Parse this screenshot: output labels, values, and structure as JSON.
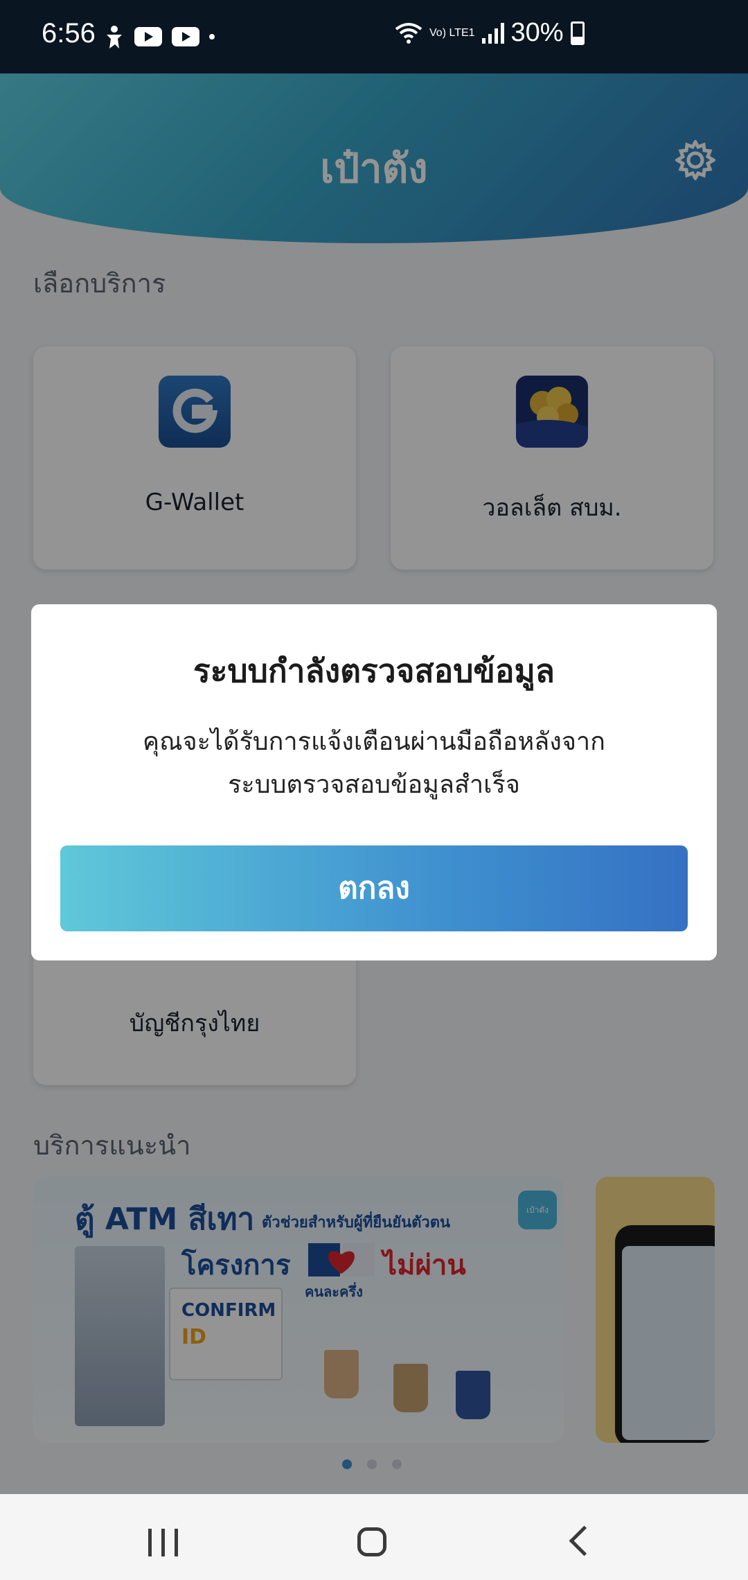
{
  "status_bar": {
    "time": "6:56",
    "network_label": "Vo) LTE1",
    "battery": "30%"
  },
  "header": {
    "title": "เป๋าตัง"
  },
  "services": {
    "section_title": "เลือกบริการ",
    "items": [
      {
        "label": "G-Wallet",
        "icon": "g-wallet-icon"
      },
      {
        "label": "วอลเล็ต สบม.",
        "icon": "coins-wallet-icon"
      },
      {
        "label": "บัญชีกรุงไทย",
        "icon": "ktb-account-icon"
      }
    ]
  },
  "recommended": {
    "section_title": "บริการแนะนำ",
    "banner1": {
      "title": "ตู้ ATM สีเทา",
      "subtitle": "ตัวช่วยสำหรับผู้ที่ยืนยันตัวตน",
      "project": "โครงการ",
      "not_pass": "ไม่ผ่าน",
      "half_half": "คนละครึ่ง",
      "confirm": "CONFIRM",
      "confirm_id": "ID",
      "badge": "เป๋าตัง"
    },
    "pager": {
      "count": 3,
      "active": 1
    }
  },
  "dialog": {
    "title": "ระบบกำลังตรวจสอบข้อมูล",
    "message_line1": "คุณจะได้รับการแจ้งเตือนผ่านมือถือหลังจาก",
    "message_line2": "ระบบตรวจสอบข้อมูลสำเร็จ",
    "ok_button": "ตกลง"
  },
  "colors": {
    "header_gradient": [
      "#5ed1e3",
      "#2f74b5"
    ],
    "button_gradient": [
      "#5fc8d9",
      "#3571c3"
    ],
    "brand_blue": "#1d4f9c",
    "alert_red": "#e0252c"
  }
}
